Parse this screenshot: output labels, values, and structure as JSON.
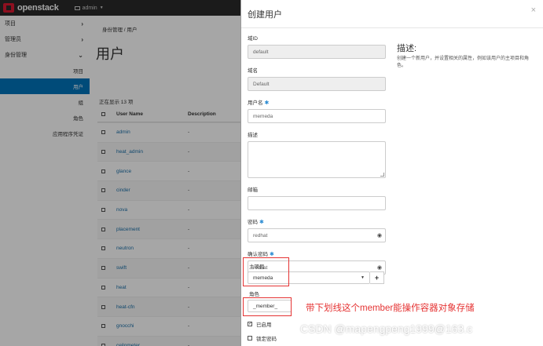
{
  "navbar": {
    "brand": "openstack",
    "project": "admin"
  },
  "sidebar": {
    "items": [
      {
        "label": "项目"
      },
      {
        "label": "管理员"
      },
      {
        "label": "身份管理"
      }
    ],
    "subitems": [
      {
        "label": "项目",
        "active": false
      },
      {
        "label": "用户",
        "active": true
      },
      {
        "label": "组",
        "active": false
      },
      {
        "label": "角色",
        "active": false
      },
      {
        "label": "应用程序凭证",
        "active": false
      }
    ]
  },
  "main": {
    "breadcrumb": "身份管理 / 用户",
    "title": "用户",
    "showing": "正在显示 13 项",
    "columns": {
      "name": "User Name",
      "desc": "Description"
    },
    "rows": [
      {
        "name": "admin",
        "desc": "-"
      },
      {
        "name": "heat_admin",
        "desc": "-"
      },
      {
        "name": "glance",
        "desc": "-"
      },
      {
        "name": "cinder",
        "desc": "-"
      },
      {
        "name": "nova",
        "desc": "-"
      },
      {
        "name": "placement",
        "desc": "-"
      },
      {
        "name": "neutron",
        "desc": "-"
      },
      {
        "name": "swift",
        "desc": "-"
      },
      {
        "name": "heat",
        "desc": "-"
      },
      {
        "name": "heat-cfn",
        "desc": "-"
      },
      {
        "name": "gnocchi",
        "desc": "-"
      },
      {
        "name": "ceilometer",
        "desc": "-"
      }
    ]
  },
  "modal": {
    "title": "创建用户",
    "close": "×",
    "domain_id_label": "域ID",
    "domain_id_value": "default",
    "domain_name_label": "域名",
    "domain_name_value": "Default",
    "username_label": "用户名",
    "username_value": "memeda",
    "description_label": "描述",
    "email_label": "邮箱",
    "password_label": "密码",
    "password_value": "redhat",
    "confirm_label": "确认密码",
    "confirm_value": "redhat",
    "project_label": "主项目",
    "project_value": "memeda",
    "role_label": "角色",
    "role_value": "_member_",
    "enabled_label": "已启用",
    "locked_label": "锁定密码",
    "desc_heading": "描述:",
    "desc_text": "创建一个新用户，并设置相关的属性，例如该用户的主项目和角色。"
  },
  "annotation": "带下划线这个member能操作容器对象存储",
  "watermark": "CSDN @mapengpeng1999@163.c",
  "colors": {
    "accent": "#0073bb",
    "annotation": "#e53333",
    "brand": "#da1a32"
  }
}
